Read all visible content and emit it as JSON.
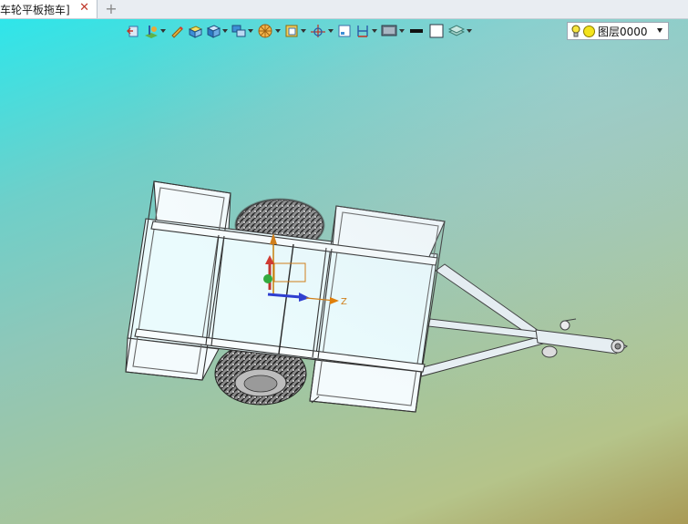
{
  "tab": {
    "title": "车轮平板拖车]",
    "close_glyph": "✕",
    "new_glyph": "+"
  },
  "toolbar": {
    "icons": [
      "exit-icon",
      "sketch-plane-icon",
      "pencil-icon",
      "box-view-icon",
      "cube-view-icon",
      "layer-display-icon",
      "render-mode-icon",
      "section-view-icon",
      "axis-icon",
      "frame-icon",
      "dimension-icon",
      "background-icon",
      "line-color-icon",
      "fill-color-icon",
      "layers-icon"
    ],
    "colors": {
      "line": "#111111",
      "fill": "#ffffff",
      "accent": "#e07b00"
    }
  },
  "layer": {
    "name": "图层0000",
    "bulb_color": "#f7e640",
    "sun_color": "#f3e31c"
  },
  "triad": {
    "z_label": "Z"
  },
  "viewport": {
    "gradient_top": "#2ee6ea",
    "gradient_bottom": "#a99a55"
  }
}
